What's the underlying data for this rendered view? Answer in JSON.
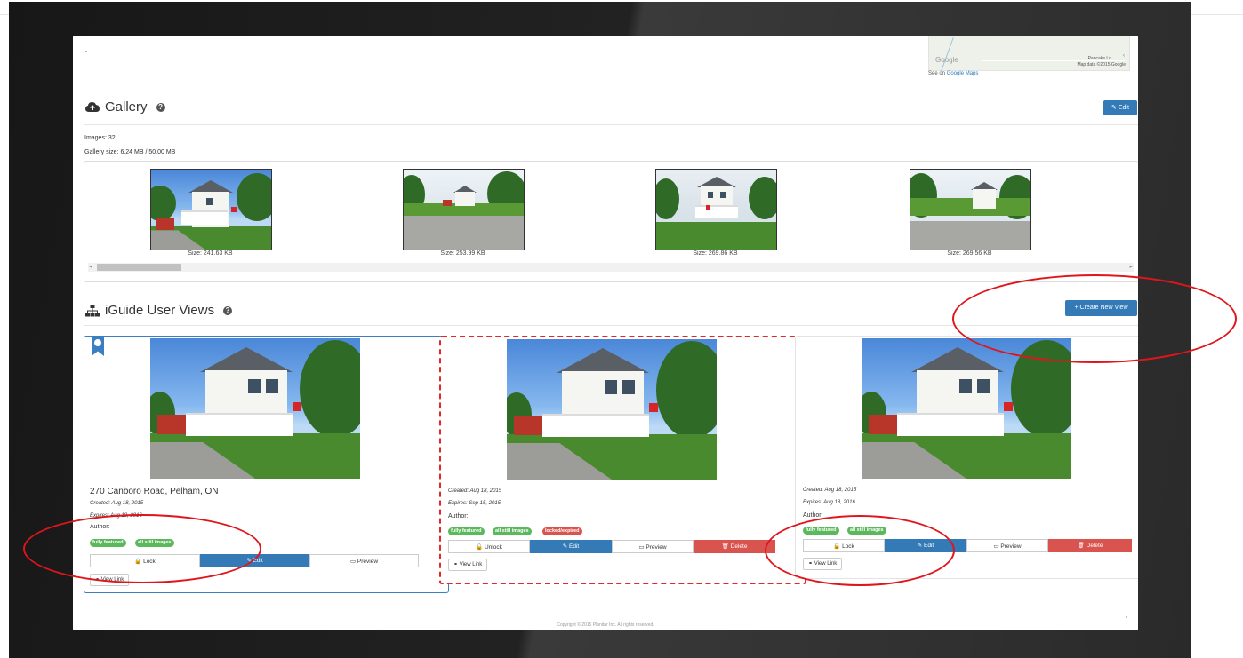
{
  "map": {
    "logo_text": "Google",
    "street_label": "Pancake Ln",
    "credit": "Map data ©2015 Google",
    "see_on": "See on",
    "link_text": "Google Maps"
  },
  "gallery": {
    "title": "Gallery",
    "edit_label": "Edit",
    "images_count": "Images: 32",
    "gallery_size": "Gallery size: 6.24 MB / 50.00 MB",
    "thumbnails": [
      {
        "caption": "Size: 241.63 KB"
      },
      {
        "caption": "Size: 253.99 KB"
      },
      {
        "caption": "Size: 269.86 KB"
      },
      {
        "caption": "Size: 269.56 KB"
      }
    ],
    "scroll_left": "◂",
    "scroll_right": "▸"
  },
  "views": {
    "title": "iGuide User Views",
    "create_label": "Create New View",
    "cards": [
      {
        "address": "270 Canboro Road, Pelham, ON",
        "created": "Created: Aug 18, 2015",
        "expires": "Expires: Aug 18, 2016",
        "author": "Author:",
        "badges": [
          "fully featured",
          "all still images"
        ],
        "buttons": [
          "Lock",
          "Edit",
          "Preview"
        ],
        "view_link": "View Link"
      },
      {
        "created": "Created: Aug 18, 2015",
        "expires": "Expires: Sep 15, 2015",
        "author": "Author:",
        "badges": [
          "fully featured",
          "all still images",
          "locked/expired"
        ],
        "buttons": [
          "Unlock",
          "Edit",
          "Preview",
          "Delete"
        ],
        "view_link": "View Link"
      },
      {
        "created": "Created: Aug 18, 2015",
        "expires": "Expires: Aug 18, 2016",
        "author": "Author:",
        "badges": [
          "fully featured",
          "all still images"
        ],
        "buttons": [
          "Lock",
          "Edit",
          "Preview",
          "Delete"
        ],
        "view_link": "View Link"
      }
    ]
  },
  "footer": {
    "copyright": "Copyright © 2015 Planitar Inc. All rights reserved."
  },
  "icons": {
    "gallery": "cloud-upload-icon",
    "views": "sitemap-icon",
    "help": "question-circle-icon",
    "featured": "globe-ribbon-icon"
  },
  "colors": {
    "primary": "#337ab7",
    "success": "#5cb85c",
    "danger": "#d9534f",
    "annotation": "#e0151b"
  }
}
